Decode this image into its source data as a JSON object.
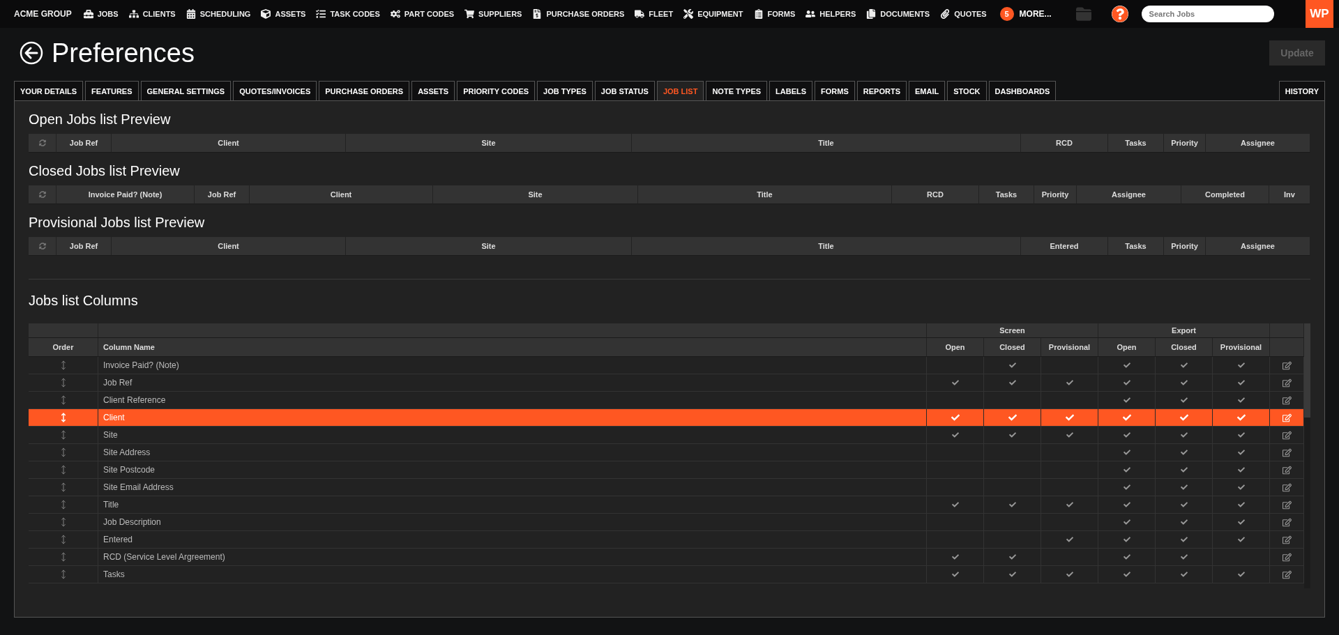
{
  "nav": {
    "brand": "ACME GROUP",
    "items": [
      "JOBS",
      "CLIENTS",
      "SCHEDULING",
      "ASSETS",
      "TASK CODES",
      "PART CODES",
      "SUPPLIERS",
      "PURCHASE ORDERS",
      "FLEET",
      "EQUIPMENT",
      "FORMS",
      "HELPERS",
      "DOCUMENTS",
      "QUOTES"
    ],
    "more_count": "5",
    "more_label": "MORE...",
    "search": {
      "placeholder": "Search Jobs"
    },
    "logo": "WP"
  },
  "page": {
    "title": "Preferences",
    "update_button": {
      "label": "Update",
      "disabled": true
    }
  },
  "tabs": [
    {
      "label": "YOUR DETAILS",
      "selected": false
    },
    {
      "label": "FEATURES",
      "selected": false
    },
    {
      "label": "GENERAL SETTINGS",
      "selected": false
    },
    {
      "label": "QUOTES/INVOICES",
      "selected": false
    },
    {
      "label": "PURCHASE ORDERS",
      "selected": false
    },
    {
      "label": "ASSETS",
      "selected": false
    },
    {
      "label": "PRIORITY CODES",
      "selected": false
    },
    {
      "label": "JOB TYPES",
      "selected": false
    },
    {
      "label": "JOB STATUS",
      "selected": false
    },
    {
      "label": "JOB LIST",
      "selected": true
    },
    {
      "label": "NOTE TYPES",
      "selected": false
    },
    {
      "label": "LABELS",
      "selected": false
    },
    {
      "label": "FORMS",
      "selected": false
    },
    {
      "label": "REPORTS",
      "selected": false
    },
    {
      "label": "EMAIL",
      "selected": false
    },
    {
      "label": "STOCK",
      "selected": false
    },
    {
      "label": "DASHBOARDS",
      "selected": false
    }
  ],
  "history_tab": {
    "label": "HISTORY",
    "selected": false
  },
  "previews": [
    {
      "title": "Open Jobs list Preview",
      "columns": [
        "Job Ref",
        "Client",
        "Site",
        "Title",
        "RCD",
        "Tasks",
        "Priority",
        "Assignee"
      ]
    },
    {
      "title": "Closed Jobs list Preview",
      "columns": [
        "Invoice Paid? (Note)",
        "Job Ref",
        "Client",
        "Site",
        "Title",
        "RCD",
        "Tasks",
        "Priority",
        "Assignee",
        "Completed",
        "Inv"
      ]
    },
    {
      "title": "Provisional Jobs list Preview",
      "columns": [
        "Job Ref",
        "Client",
        "Site",
        "Title",
        "Entered",
        "Tasks",
        "Priority",
        "Assignee"
      ]
    }
  ],
  "columns_table": {
    "title": "Jobs list Columns",
    "groups": [
      {
        "label": "Screen",
        "subcolumns": [
          "Open",
          "Closed",
          "Provisional"
        ]
      },
      {
        "label": "Export",
        "subcolumns": [
          "Open",
          "Closed",
          "Provisional"
        ]
      }
    ],
    "columns": [
      "Order",
      "Column Name"
    ],
    "rows": [
      {
        "name": "Invoice Paid? (Note)",
        "selected": false,
        "screen": [
          false,
          true,
          false
        ],
        "export": [
          true,
          true,
          true
        ]
      },
      {
        "name": "Job Ref",
        "selected": false,
        "screen": [
          true,
          true,
          true
        ],
        "export": [
          true,
          true,
          true
        ]
      },
      {
        "name": "Client Reference",
        "selected": false,
        "screen": [
          false,
          false,
          false
        ],
        "export": [
          true,
          true,
          true
        ]
      },
      {
        "name": "Client",
        "selected": true,
        "screen": [
          true,
          true,
          true
        ],
        "export": [
          true,
          true,
          true
        ]
      },
      {
        "name": "Site",
        "selected": false,
        "screen": [
          true,
          true,
          true
        ],
        "export": [
          true,
          true,
          true
        ]
      },
      {
        "name": "Site Address",
        "selected": false,
        "screen": [
          false,
          false,
          false
        ],
        "export": [
          true,
          true,
          true
        ]
      },
      {
        "name": "Site Postcode",
        "selected": false,
        "screen": [
          false,
          false,
          false
        ],
        "export": [
          true,
          true,
          true
        ]
      },
      {
        "name": "Site Email Address",
        "selected": false,
        "screen": [
          false,
          false,
          false
        ],
        "export": [
          true,
          true,
          true
        ]
      },
      {
        "name": "Title",
        "selected": false,
        "screen": [
          true,
          true,
          true
        ],
        "export": [
          true,
          true,
          true
        ]
      },
      {
        "name": "Job Description",
        "selected": false,
        "screen": [
          false,
          false,
          false
        ],
        "export": [
          true,
          true,
          true
        ]
      },
      {
        "name": "Entered",
        "selected": false,
        "screen": [
          false,
          false,
          true
        ],
        "export": [
          true,
          true,
          true
        ]
      },
      {
        "name": "RCD (Service Level Argreement)",
        "selected": false,
        "screen": [
          true,
          true,
          false
        ],
        "export": [
          true,
          true,
          false
        ]
      },
      {
        "name": "Tasks",
        "selected": false,
        "screen": [
          true,
          true,
          true
        ],
        "export": [
          true,
          true,
          true
        ]
      }
    ]
  }
}
